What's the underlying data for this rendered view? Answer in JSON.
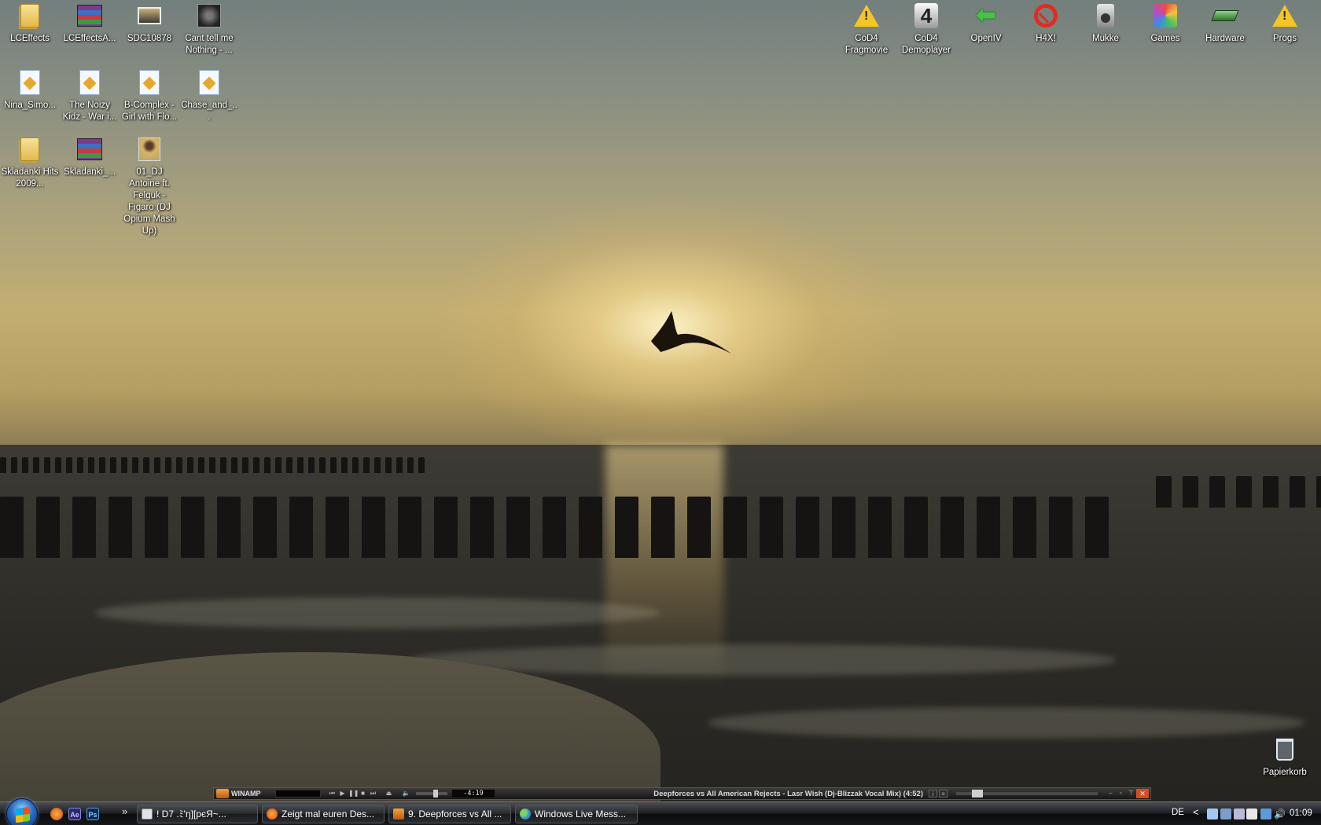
{
  "desktop": {
    "left_icons": [
      {
        "label": "LCEffects",
        "icon": "folder-icon"
      },
      {
        "label": "LCEffectsA...",
        "icon": "winrar-archive-icon"
      },
      {
        "label": "SDC10878",
        "icon": "photo-icon"
      },
      {
        "label": "Cant tell me Nothing - ...",
        "icon": "album-art-icon"
      },
      {
        "label": "Nina_Simo...",
        "icon": "audio-file-icon"
      },
      {
        "label": "The Noizy Kidz - War i...",
        "icon": "audio-file-icon"
      },
      {
        "label": "B-Complex - Girl with Flo...",
        "icon": "audio-file-icon"
      },
      {
        "label": "Chase_and_...",
        "icon": "audio-file-icon"
      },
      {
        "label": "Skladanki Hits 2009...",
        "icon": "folder-icon"
      },
      {
        "label": "Skladanki_...",
        "icon": "winrar-archive-icon"
      },
      {
        "label": "01_DJ Antoine ft. Felguk - Figaro (DJ Opium Mash Up)",
        "icon": "portrait-image-icon"
      }
    ],
    "right_icons": [
      {
        "label": "CoD4 Fragmovie",
        "icon": "warning-icon"
      },
      {
        "label": "CoD4 Demoplayer",
        "icon": "cod4-icon"
      },
      {
        "label": "OpenIV",
        "icon": "green-arrow-icon"
      },
      {
        "label": "H4X!",
        "icon": "no-entry-icon"
      },
      {
        "label": "Mukke",
        "icon": "speaker-icon"
      },
      {
        "label": "Games",
        "icon": "games-folder-icon"
      },
      {
        "label": "Hardware",
        "icon": "hardware-icon"
      },
      {
        "label": "Progs",
        "icon": "warning-icon"
      }
    ],
    "recycle_bin": {
      "label": "Papierkorb",
      "icon": "recycle-bin-icon"
    }
  },
  "winamp": {
    "title": "WINAMP",
    "time": "-4:19",
    "track": "Deepforces vs All American Rejects - Lasr Wish (Dj-Blizzak Vocal Mix) (4:52)",
    "buttons": [
      "previous",
      "play",
      "pause",
      "stop",
      "next",
      "eject"
    ]
  },
  "taskbar": {
    "quick_launch": [
      {
        "name": "firefox-icon",
        "glyph": ""
      },
      {
        "name": "after-effects-icon",
        "glyph": "Ae"
      },
      {
        "name": "photoshop-icon",
        "glyph": "Ps"
      }
    ],
    "more_glyph": "»",
    "tasks": [
      {
        "label": "!     D7 .ﾐ'ŋ][pєЯ~...",
        "icon": "window-icon"
      },
      {
        "label": "Zeigt mal euren Des...",
        "icon": "firefox-icon"
      },
      {
        "label": "9. Deepforces vs All ...",
        "icon": "winamp-icon"
      },
      {
        "label": "Windows Live Mess...",
        "icon": "messenger-icon"
      }
    ],
    "tray": {
      "language": "DE",
      "chevron": "<",
      "clock": "01:09"
    }
  },
  "colors": {
    "taskbar_bg": "#1d1f23",
    "winamp_accent": "#d84c20",
    "sky_top": "#737f7d",
    "sun": "#fff4c8"
  }
}
